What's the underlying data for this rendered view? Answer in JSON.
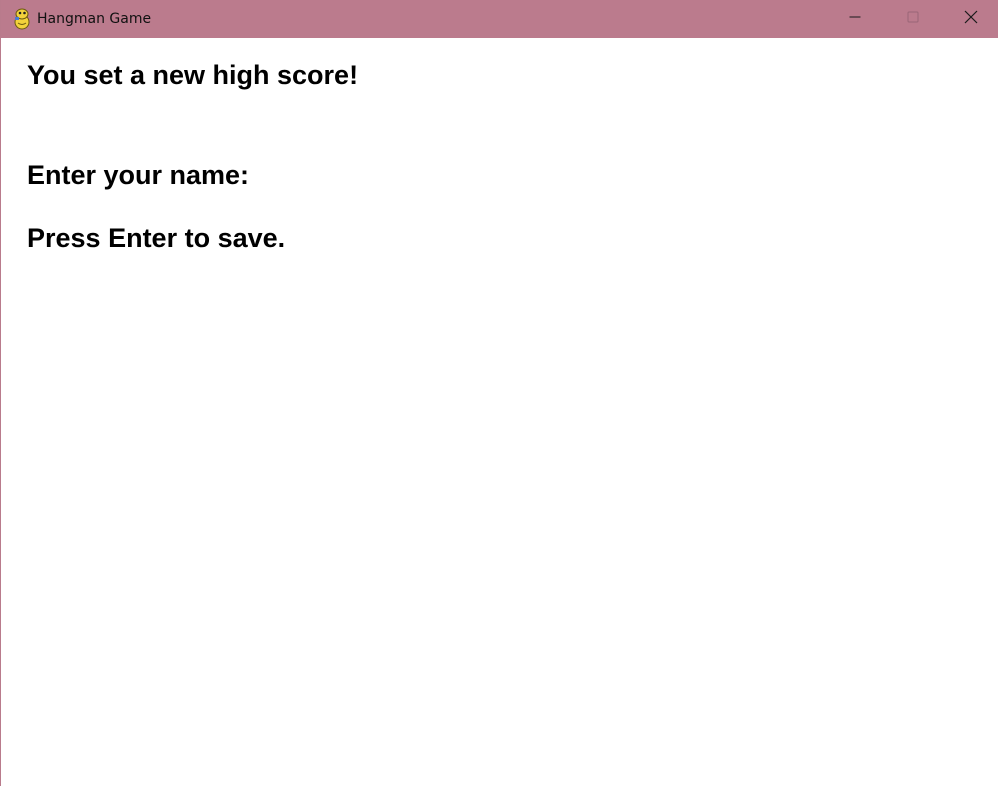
{
  "window": {
    "title": "Hangman Game",
    "app_icon": "pygame-snake-icon",
    "titlebar_color": "#bb7b8d",
    "controls": {
      "minimize": "minimize-icon",
      "maximize": "maximize-icon",
      "close": "close-icon"
    }
  },
  "screen": {
    "headline": "You set a new high score!",
    "name_prompt": "Enter your name:",
    "name_value": "",
    "instruction": "Press Enter to save."
  }
}
